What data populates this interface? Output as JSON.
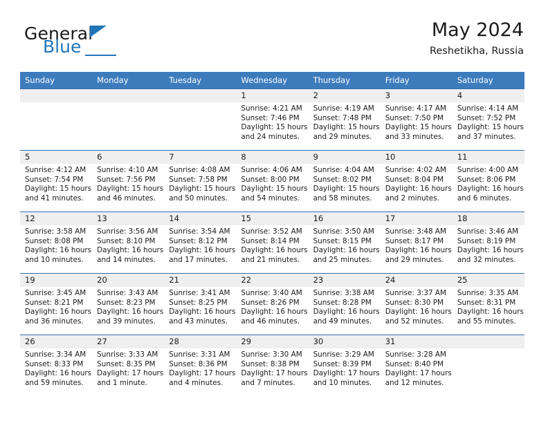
{
  "brand": {
    "name_part1": "General",
    "name_part2": "Blue",
    "logo_icon": "triangle-logo"
  },
  "header": {
    "title": "May 2024",
    "subtitle": "Reshetikha, Russia"
  },
  "colors": {
    "header_blue": "#3c7cbd",
    "rule_blue": "#2f6fae",
    "daynum_bg": "#efefef",
    "brand_blue": "#2175b8"
  },
  "calendar": {
    "weekday_headers": [
      "Sunday",
      "Monday",
      "Tuesday",
      "Wednesday",
      "Thursday",
      "Friday",
      "Saturday"
    ],
    "weeks": [
      [
        {
          "day": "",
          "lines": []
        },
        {
          "day": "",
          "lines": []
        },
        {
          "day": "",
          "lines": []
        },
        {
          "day": "1",
          "lines": [
            "Sunrise: 4:21 AM",
            "Sunset: 7:46 PM",
            "Daylight: 15 hours",
            "and 24 minutes."
          ]
        },
        {
          "day": "2",
          "lines": [
            "Sunrise: 4:19 AM",
            "Sunset: 7:48 PM",
            "Daylight: 15 hours",
            "and 29 minutes."
          ]
        },
        {
          "day": "3",
          "lines": [
            "Sunrise: 4:17 AM",
            "Sunset: 7:50 PM",
            "Daylight: 15 hours",
            "and 33 minutes."
          ]
        },
        {
          "day": "4",
          "lines": [
            "Sunrise: 4:14 AM",
            "Sunset: 7:52 PM",
            "Daylight: 15 hours",
            "and 37 minutes."
          ]
        }
      ],
      [
        {
          "day": "5",
          "lines": [
            "Sunrise: 4:12 AM",
            "Sunset: 7:54 PM",
            "Daylight: 15 hours",
            "and 41 minutes."
          ]
        },
        {
          "day": "6",
          "lines": [
            "Sunrise: 4:10 AM",
            "Sunset: 7:56 PM",
            "Daylight: 15 hours",
            "and 46 minutes."
          ]
        },
        {
          "day": "7",
          "lines": [
            "Sunrise: 4:08 AM",
            "Sunset: 7:58 PM",
            "Daylight: 15 hours",
            "and 50 minutes."
          ]
        },
        {
          "day": "8",
          "lines": [
            "Sunrise: 4:06 AM",
            "Sunset: 8:00 PM",
            "Daylight: 15 hours",
            "and 54 minutes."
          ]
        },
        {
          "day": "9",
          "lines": [
            "Sunrise: 4:04 AM",
            "Sunset: 8:02 PM",
            "Daylight: 15 hours",
            "and 58 minutes."
          ]
        },
        {
          "day": "10",
          "lines": [
            "Sunrise: 4:02 AM",
            "Sunset: 8:04 PM",
            "Daylight: 16 hours",
            "and 2 minutes."
          ]
        },
        {
          "day": "11",
          "lines": [
            "Sunrise: 4:00 AM",
            "Sunset: 8:06 PM",
            "Daylight: 16 hours",
            "and 6 minutes."
          ]
        }
      ],
      [
        {
          "day": "12",
          "lines": [
            "Sunrise: 3:58 AM",
            "Sunset: 8:08 PM",
            "Daylight: 16 hours",
            "and 10 minutes."
          ]
        },
        {
          "day": "13",
          "lines": [
            "Sunrise: 3:56 AM",
            "Sunset: 8:10 PM",
            "Daylight: 16 hours",
            "and 14 minutes."
          ]
        },
        {
          "day": "14",
          "lines": [
            "Sunrise: 3:54 AM",
            "Sunset: 8:12 PM",
            "Daylight: 16 hours",
            "and 17 minutes."
          ]
        },
        {
          "day": "15",
          "lines": [
            "Sunrise: 3:52 AM",
            "Sunset: 8:14 PM",
            "Daylight: 16 hours",
            "and 21 minutes."
          ]
        },
        {
          "day": "16",
          "lines": [
            "Sunrise: 3:50 AM",
            "Sunset: 8:15 PM",
            "Daylight: 16 hours",
            "and 25 minutes."
          ]
        },
        {
          "day": "17",
          "lines": [
            "Sunrise: 3:48 AM",
            "Sunset: 8:17 PM",
            "Daylight: 16 hours",
            "and 29 minutes."
          ]
        },
        {
          "day": "18",
          "lines": [
            "Sunrise: 3:46 AM",
            "Sunset: 8:19 PM",
            "Daylight: 16 hours",
            "and 32 minutes."
          ]
        }
      ],
      [
        {
          "day": "19",
          "lines": [
            "Sunrise: 3:45 AM",
            "Sunset: 8:21 PM",
            "Daylight: 16 hours",
            "and 36 minutes."
          ]
        },
        {
          "day": "20",
          "lines": [
            "Sunrise: 3:43 AM",
            "Sunset: 8:23 PM",
            "Daylight: 16 hours",
            "and 39 minutes."
          ]
        },
        {
          "day": "21",
          "lines": [
            "Sunrise: 3:41 AM",
            "Sunset: 8:25 PM",
            "Daylight: 16 hours",
            "and 43 minutes."
          ]
        },
        {
          "day": "22",
          "lines": [
            "Sunrise: 3:40 AM",
            "Sunset: 8:26 PM",
            "Daylight: 16 hours",
            "and 46 minutes."
          ]
        },
        {
          "day": "23",
          "lines": [
            "Sunrise: 3:38 AM",
            "Sunset: 8:28 PM",
            "Daylight: 16 hours",
            "and 49 minutes."
          ]
        },
        {
          "day": "24",
          "lines": [
            "Sunrise: 3:37 AM",
            "Sunset: 8:30 PM",
            "Daylight: 16 hours",
            "and 52 minutes."
          ]
        },
        {
          "day": "25",
          "lines": [
            "Sunrise: 3:35 AM",
            "Sunset: 8:31 PM",
            "Daylight: 16 hours",
            "and 55 minutes."
          ]
        }
      ],
      [
        {
          "day": "26",
          "lines": [
            "Sunrise: 3:34 AM",
            "Sunset: 8:33 PM",
            "Daylight: 16 hours",
            "and 59 minutes."
          ]
        },
        {
          "day": "27",
          "lines": [
            "Sunrise: 3:33 AM",
            "Sunset: 8:35 PM",
            "Daylight: 17 hours",
            "and 1 minute."
          ]
        },
        {
          "day": "28",
          "lines": [
            "Sunrise: 3:31 AM",
            "Sunset: 8:36 PM",
            "Daylight: 17 hours",
            "and 4 minutes."
          ]
        },
        {
          "day": "29",
          "lines": [
            "Sunrise: 3:30 AM",
            "Sunset: 8:38 PM",
            "Daylight: 17 hours",
            "and 7 minutes."
          ]
        },
        {
          "day": "30",
          "lines": [
            "Sunrise: 3:29 AM",
            "Sunset: 8:39 PM",
            "Daylight: 17 hours",
            "and 10 minutes."
          ]
        },
        {
          "day": "31",
          "lines": [
            "Sunrise: 3:28 AM",
            "Sunset: 8:40 PM",
            "Daylight: 17 hours",
            "and 12 minutes."
          ]
        },
        {
          "day": "",
          "lines": []
        }
      ]
    ]
  }
}
